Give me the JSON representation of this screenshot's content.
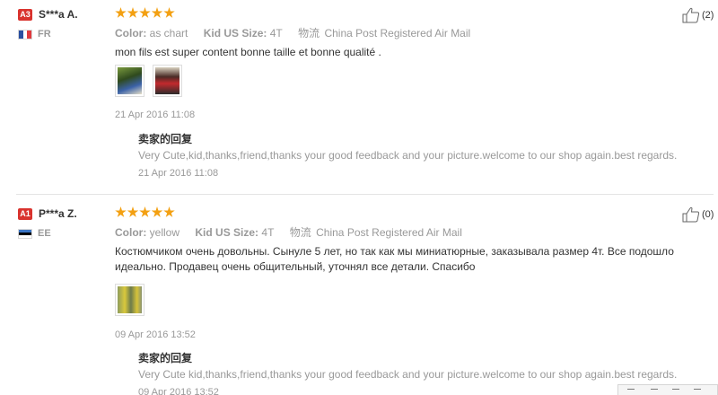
{
  "reviews": [
    {
      "level": "A3",
      "buyer": "S***a A.",
      "country": "FR",
      "rating": 5,
      "color_label": "Color:",
      "color_value": "as chart",
      "size_label": "Kid US Size:",
      "size_value": "4T",
      "logistics_label": "物流",
      "logistics_value": "China Post Registered Air Mail",
      "text": "mon fils est super content bonne taille et bonne qualité .",
      "photos": [
        "img-a",
        "img-b"
      ],
      "date": "21 Apr 2016 11:08",
      "reply_title": "卖家的回复",
      "reply_text": "Very Cute,kid,thanks,friend,thanks your good feedback and your picture.welcome to our shop again.best regards.",
      "reply_date": "21 Apr 2016 11:08",
      "helpful": "(2)"
    },
    {
      "level": "A1",
      "buyer": "P***a Z.",
      "country": "EE",
      "rating": 5,
      "color_label": "Color:",
      "color_value": "yellow",
      "size_label": "Kid US Size:",
      "size_value": "4T",
      "logistics_label": "物流",
      "logistics_value": "China Post Registered Air Mail",
      "text": "Костюмчиком очень довольны. Сынуле 5 лет, но так как мы миниатюрные, заказывала размер 4т. Все подошло идеально. Продавец очень общительный, уточнял все детали. Спасибо",
      "photos": [
        "img-c"
      ],
      "date": "09 Apr 2016 13:52",
      "reply_title": "卖家的回复",
      "reply_text": "Very Cute kid,thanks,friend,thanks your good feedback and your picture.welcome to our shop again.best regards.",
      "reply_date": "09 Apr 2016 13:52",
      "helpful": "(0)"
    }
  ],
  "colors": {
    "star": "#f3a012",
    "badge": "#d9332e",
    "muted": "#999999"
  },
  "icons": {
    "helpful": "thumbs-up-icon",
    "rating": "star-icon"
  }
}
